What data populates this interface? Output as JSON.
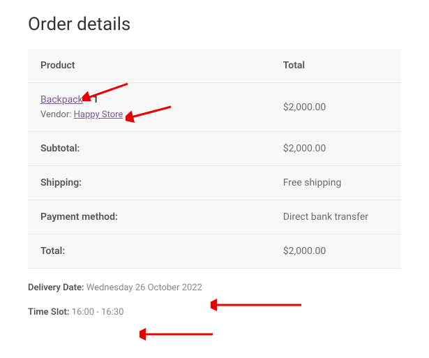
{
  "title": "Order details",
  "headers": {
    "product": "Product",
    "total": "Total"
  },
  "item": {
    "name": "Backpack",
    "quantity_prefix": "× ",
    "quantity": "1",
    "vendor_label": "Vendor: ",
    "vendor": "Happy Store",
    "total": "$2,000.00"
  },
  "totals": {
    "subtotal_label": "Subtotal:",
    "subtotal": "$2,000.00",
    "shipping_label": "Shipping:",
    "shipping": "Free shipping",
    "payment_label": "Payment method:",
    "payment": "Direct bank transfer",
    "total_label": "Total:",
    "total": "$2,000.00"
  },
  "meta": {
    "delivery_label": "Delivery Date:",
    "delivery_date": "Wednesday 26 October 2022",
    "timeslot_label": "Time Slot:",
    "timeslot": "16:00 - 16:30"
  }
}
